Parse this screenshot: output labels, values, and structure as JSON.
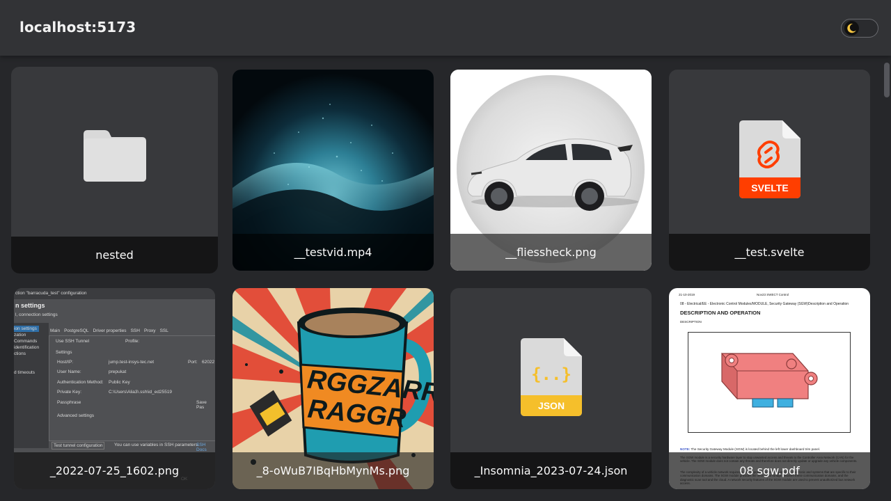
{
  "header": {
    "host": "localhost:5173",
    "theme_toggle_icon": "moon-icon"
  },
  "files": [
    {
      "name": "nested",
      "kind": "folder",
      "icon": "folder-icon"
    },
    {
      "name": "__testvid.mp4",
      "kind": "video"
    },
    {
      "name": "__fliessheck.png",
      "kind": "image"
    },
    {
      "name": "__test.svelte",
      "kind": "file",
      "icon": "svelte-file-icon",
      "badge": "SVELTE",
      "badge_color": "#ff3e00"
    },
    {
      "name": "_2022-07-25_1602.png",
      "kind": "image"
    },
    {
      "name": "_8-oWuB7IBqHbMynMs.png",
      "kind": "image"
    },
    {
      "name": "_Insomnia_2023-07-24.json",
      "kind": "file",
      "icon": "json-file-icon",
      "badge": "JSON",
      "badge_color": "#f5bf2b"
    },
    {
      "name": "08 sgw.pdf",
      "kind": "pdf"
    }
  ],
  "screenshot_thumb": {
    "title": "ction \"barracuda_test\" configuration",
    "heading": "n settings",
    "subheading": "l, connection settings",
    "sidebar": [
      "ion settings",
      "zation",
      "Commands",
      "identification",
      "ctions",
      "d timeouts"
    ],
    "tabs": [
      "Main",
      "PostgreSQL",
      "Driver properties",
      "SSH",
      "Proxy",
      "SSL"
    ],
    "use_ssh": "Use SSH Tunnel",
    "profile": "Profile:",
    "settings": "Settings",
    "host_label": "Host/IP:",
    "host_value": "jump.test-insys-tec.net",
    "port_label": "Port:",
    "port_value": "62022",
    "user_label": "User Name:",
    "user_value": "prepukat",
    "auth_label": "Authentication Method:",
    "auth_value": "Public Key",
    "key_label": "Private Key:",
    "key_value": "C:\\Users\\Alia3\\.ssh\\id_ed25519",
    "pass_label": "Passphrase",
    "save_pass": "Save Pas",
    "advanced": "Advanced settings",
    "test_tunnel": "Test tunnel configuration",
    "hint": "You can use variables in SSH parameters.",
    "link": "SSH Docs",
    "ok": "OK"
  },
  "mug_thumb": {
    "lettering_line1": "RGGZARR",
    "lettering_line2": "RAGGR"
  },
  "pdf_thumb": {
    "date": "21-10-2019",
    "center": "Nov23 SWECT Control",
    "breadcrumb": "08 - Electrical/EE - Electronic Control Modules/MODULE, Security Gateway (SGW)Description and Operation",
    "heading": "DESCRIPTION AND OPERATION",
    "subheading": "DESCRIPTION",
    "note_label": "NOTE:",
    "note": "The Security Gateway Module (SGW) is located behind the left lower dashboard trim panel.",
    "body": "The SGW module is a security hardware layer to stop unwanted access and threats to the Controller Area Network (CAN) for the vehicle. The SGW module does not contain any threats and therefore does not directly update or upgrade any vehicle components.",
    "body2": "The complexity of a vehicle network requires a new approach by isolating all of the electronic and systems that are specific to their communication domains. The SGW module provides the information bridge between these communication domains, and the diagnostic scan tool and the cloud. A network security features of the SGW module are used to prevent unauthorized bus network access."
  }
}
